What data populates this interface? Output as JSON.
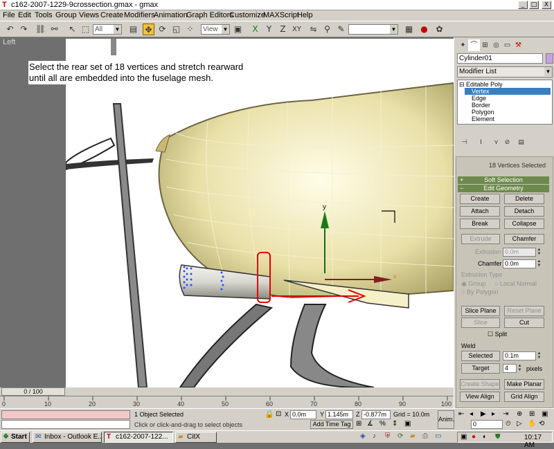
{
  "window": {
    "title": "c162-2007-1229-9crossection.gmax - gmax",
    "icon": "gmax-app-icon",
    "min": "_",
    "max": "□",
    "close": "X"
  },
  "menu": [
    "File",
    "Edit",
    "Tools",
    "Group",
    "Views",
    "Create",
    "Modifiers",
    "Animation",
    "Graph Editors",
    "Customize",
    "MAXScript",
    "Help"
  ],
  "toolbar": {
    "selection_filter": "All",
    "ref_coord": "View",
    "named_sel": ""
  },
  "viewport": {
    "label": "Left",
    "instructions": "Select the rear set of 18 vertices and stretch rearward until all are embedded into the fuselage mesh."
  },
  "command_panel": {
    "object_name": "Cylinder01",
    "object_color": "#c8a0e8",
    "modifier_list": "Modifier List",
    "stack": [
      "Editable Poly",
      "Vertex",
      "Edge",
      "Border",
      "Polygon",
      "Element"
    ],
    "selection_info": "18 Vertices Selected",
    "soft_selection": "Soft Selection",
    "edit_geometry": "Edit Geometry",
    "buttons": {
      "create": "Create",
      "delete": "Delete",
      "attach": "Attach",
      "detach": "Detach",
      "break": "Break",
      "collapse": "Collapse",
      "extrude": "Extrude",
      "chamfer": "Chamfer",
      "slice_plane": "Slice Plane",
      "reset_plane": "Reset Plane",
      "slice": "Slice",
      "cut": "Cut",
      "selected": "Selected",
      "target": "Target",
      "create_shape": "Create Shape",
      "make_planar": "Make Planar",
      "view_align": "View Align",
      "grid_align": "Grid Align"
    },
    "extrusion_label": "Extrusion",
    "extrusion_value": "0.0m",
    "chamfer_label": "Chamfer",
    "chamfer_value": "0.0m",
    "extrusion_type": "Extrusion Type",
    "radio_group": "Group",
    "radio_local_normal": "Local Normal",
    "radio_by_polygon": "By Polygon",
    "split": "Split",
    "weld": "Weld",
    "weld_selected_value": "0.1m",
    "weld_target_value": "4",
    "pixels": "pixels"
  },
  "timeline": {
    "frame": "0 / 100",
    "ticks": [
      "0",
      "10",
      "20",
      "30",
      "40",
      "50",
      "60",
      "70",
      "80",
      "90",
      "100"
    ]
  },
  "status": {
    "objects_selected": "1 Object Selected",
    "prompt": "Click or click-and-drag to select objects",
    "x_label": "X",
    "x": "0.0m",
    "y_label": "Y",
    "y": "1.145m",
    "z_label": "Z",
    "z": "-0.877m",
    "grid": "Grid = 10.0m",
    "add_time_tag": "Add Time Tag",
    "anim": "Anim.",
    "frame_field": "0"
  },
  "taskbar": {
    "start": "Start",
    "tasks": [
      "Inbox - Outlook E...",
      "c162-2007-122...",
      "CitX"
    ],
    "clock": "10:17 AM"
  }
}
